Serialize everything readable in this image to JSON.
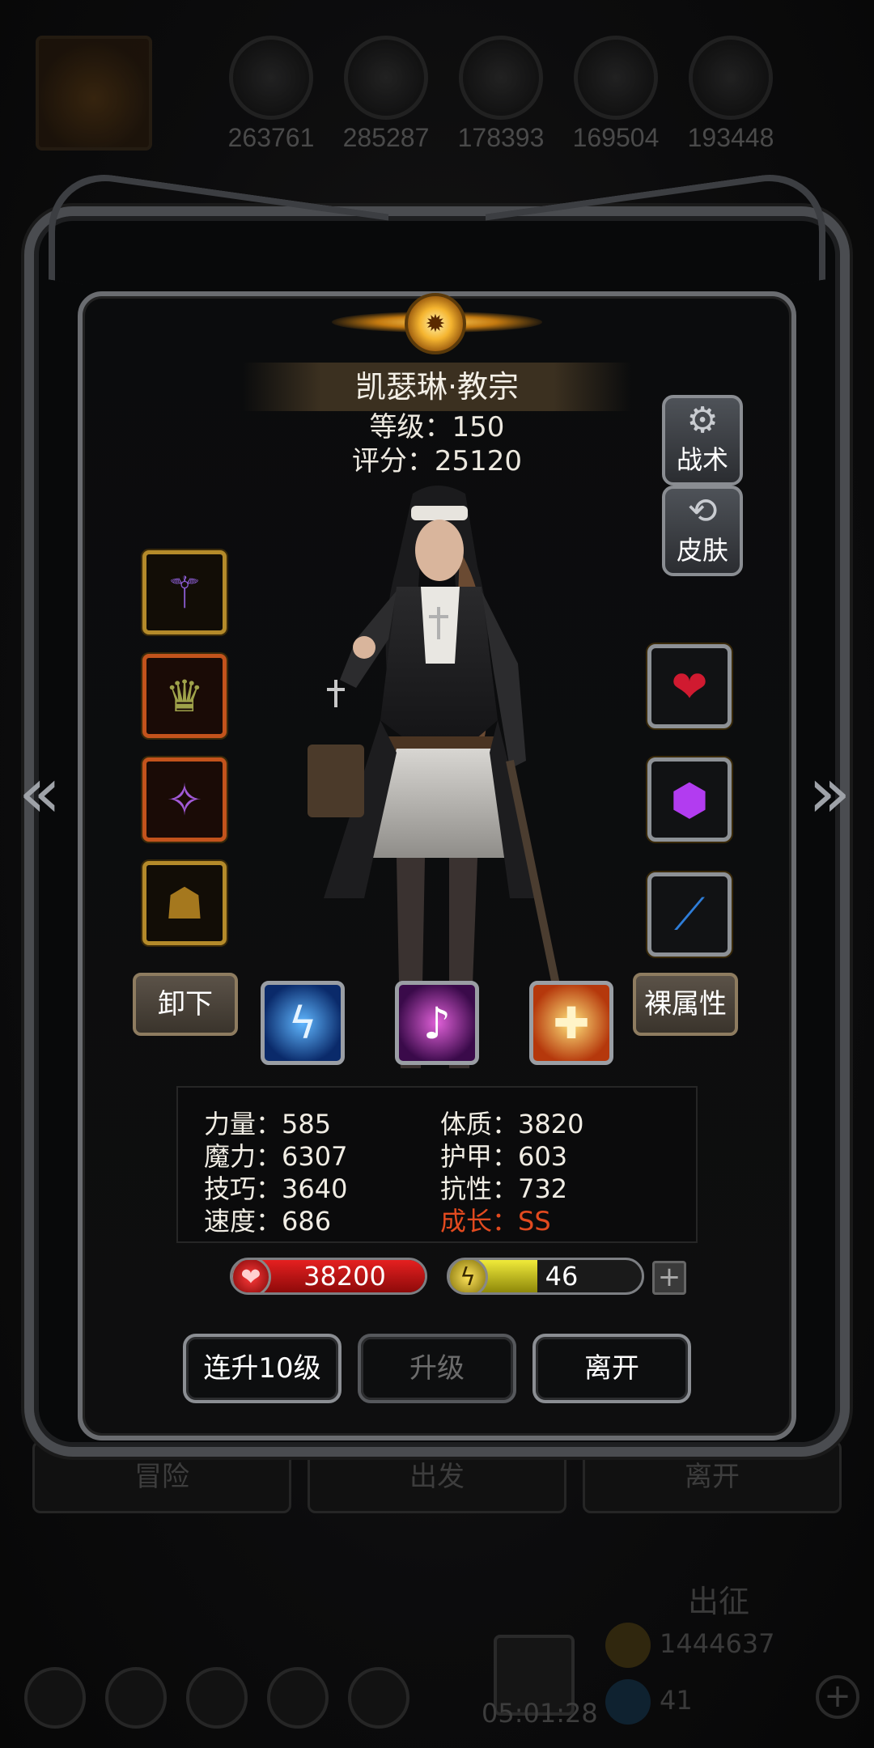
{
  "resources": {
    "values": [
      "263761",
      "285287",
      "178393",
      "169504",
      "193448"
    ]
  },
  "hero": {
    "name": "凯瑟琳·教宗",
    "level_text": "等级：150",
    "score_text": "评分：25120"
  },
  "side_buttons": {
    "tactics_label": "战术",
    "skin_label": "皮肤"
  },
  "actions": {
    "unequip_label": "卸下",
    "base_attributes_label": "裸属性"
  },
  "stats": {
    "strength": "力量：585",
    "constitution": "体质：3820",
    "magic": "魔力：6307",
    "armor": "护甲：603",
    "skill": "技巧：3640",
    "resistance": "抗性：732",
    "speed": "速度：686",
    "growth": "成长：SS"
  },
  "bars": {
    "hp_value": "38200",
    "energy_value": "46",
    "energy_fill": 0.46,
    "plus_symbol": "+"
  },
  "buttons": {
    "level_up_10": "连升10级",
    "level_up": "升级",
    "leave": "离开"
  },
  "background": {
    "tabs": [
      "冒险",
      "出发",
      "离开"
    ],
    "expedition_label": "出征",
    "gold_value": "1444637",
    "gem_value": "41",
    "timer": "05:01:28"
  },
  "colors": {
    "hp": "#c81414",
    "energy": "#c9c21a",
    "growth_highlight": "#e24a1f",
    "gold_frame": "#b48a2a",
    "orange_frame": "#c2531c"
  },
  "icons": {
    "left_slots": [
      "staff-icon",
      "crown-icon",
      "necklace-icon",
      "bell-icon"
    ],
    "right_slots": [
      "heart-gem-icon",
      "purple-crystal-icon",
      "blue-feather-icon"
    ],
    "skills": [
      "lightning-skill-icon",
      "music-skill-icon",
      "holy-cross-skill-icon"
    ]
  }
}
